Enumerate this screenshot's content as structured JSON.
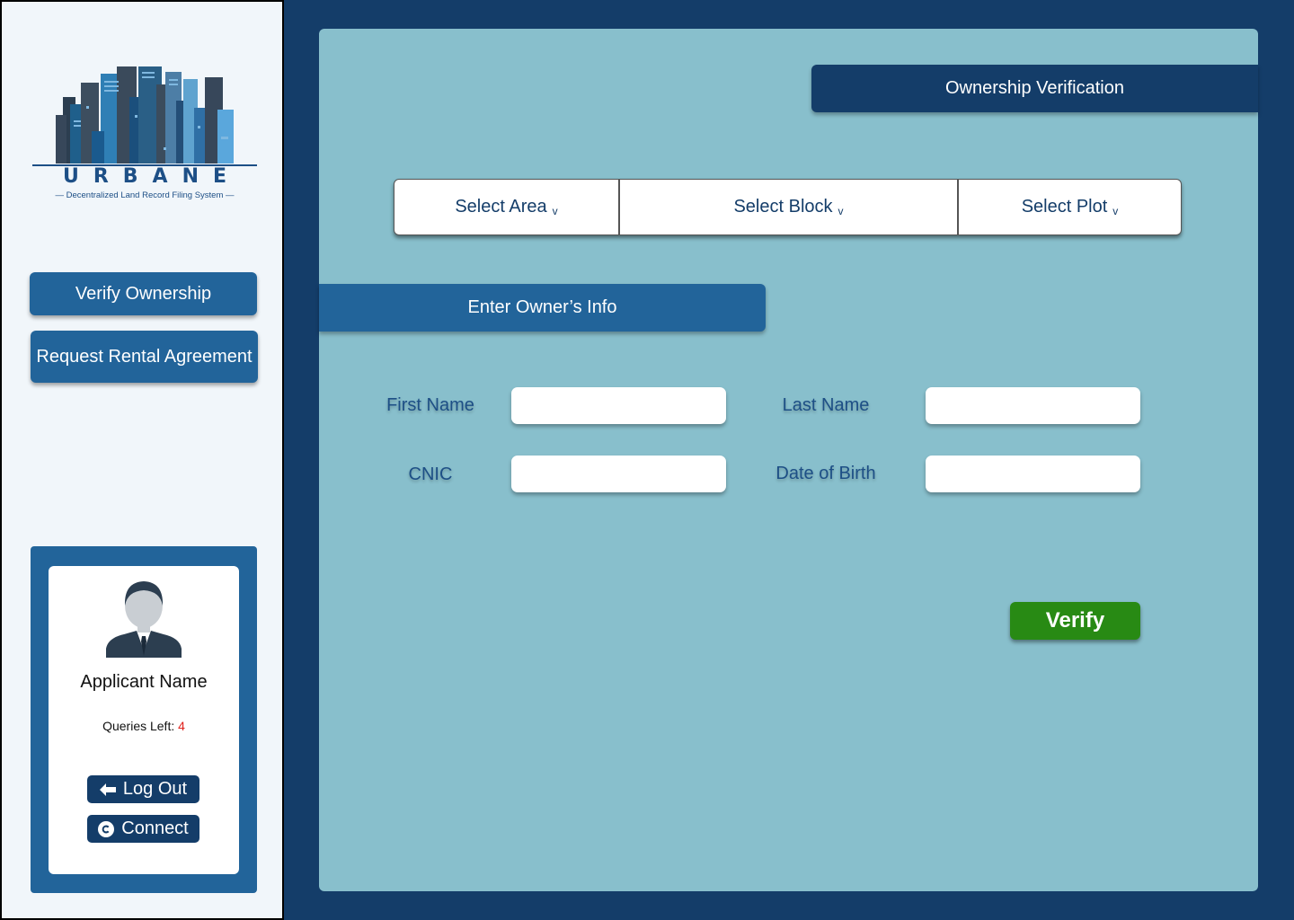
{
  "sidebar": {
    "logo": {
      "wordmark": "URBANE",
      "tagline": "— Decentralized Land Record Filing System —"
    },
    "nav": {
      "verify_ownership": "Verify Ownership",
      "request_rental": "Request Rental Agreement"
    },
    "profile": {
      "name": "Applicant Name",
      "queries_label": "Queries Left: ",
      "queries_count": "4",
      "logout_label": "Log Out",
      "connect_label": "Connect"
    }
  },
  "main": {
    "title": "Ownership Verification",
    "selectors": {
      "area": "Select Area",
      "block": "Select Block",
      "plot": "Select Plot",
      "chevron": "v"
    },
    "section_title": "Enter Owner’s Info",
    "fields": {
      "first_name": {
        "label": "First Name",
        "value": ""
      },
      "last_name": {
        "label": "Last Name",
        "value": ""
      },
      "cnic": {
        "label": "CNIC",
        "value": ""
      },
      "dob": {
        "label": "Date of Birth",
        "value": ""
      }
    },
    "verify_label": "Verify"
  },
  "colors": {
    "navy": "#143d69",
    "blue": "#22649a",
    "panel": "#88bfcc",
    "sidebar_bg": "#f1f6fa",
    "success": "#288a14",
    "queries_count": "#e0201b"
  },
  "icons": [
    "city-skyline-logo-icon",
    "person-avatar-icon",
    "arrow-left-icon",
    "connect-icon",
    "chevron-down-icon"
  ]
}
